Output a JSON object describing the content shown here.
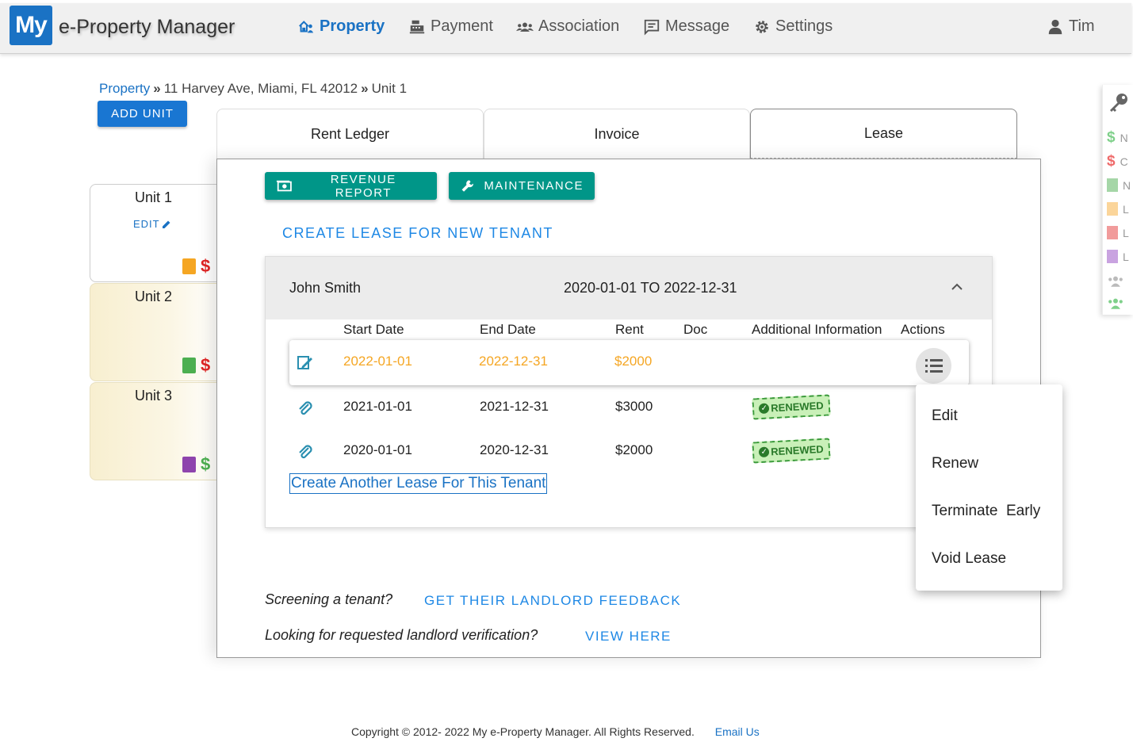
{
  "app": {
    "logo": "My",
    "title": "e-Property Manager"
  },
  "nav": {
    "items": [
      {
        "label": "Property",
        "icon": "house-people-icon"
      },
      {
        "label": "Payment",
        "icon": "cash-register-icon"
      },
      {
        "label": "Association",
        "icon": "users-icon"
      },
      {
        "label": "Message",
        "icon": "message-icon"
      },
      {
        "label": "Settings",
        "icon": "gear-icon"
      }
    ],
    "user": "Tim",
    "active": "Property"
  },
  "breadcrumb": {
    "root": "Property",
    "address": "11 Harvey Ave, Miami, FL 42012",
    "unit": "Unit 1",
    "sep": "»"
  },
  "add_unit_label": "ADD UNIT",
  "units": [
    {
      "name": "Unit 1",
      "edit": "EDIT",
      "doc_color": "#f5a623",
      "dollar_color": "#e02424"
    },
    {
      "name": "Unit 2",
      "doc_color": "#4caf50",
      "dollar_color": "#e02424"
    },
    {
      "name": "Unit 3",
      "doc_color": "#8e44ad",
      "dollar_color": "#4caf50"
    }
  ],
  "tabs": [
    {
      "label": "Rent Ledger"
    },
    {
      "label": "Invoice"
    },
    {
      "label": "Lease"
    }
  ],
  "buttons": {
    "revenue": "REVENUE REPORT",
    "maintenance": "MAINTENANCE"
  },
  "create_lease": "CREATE LEASE FOR NEW TENANT",
  "lease": {
    "tenant": "John Smith",
    "period": "2020-01-01 TO 2022-12-31",
    "headers": {
      "start": "Start Date",
      "end": "End Date",
      "rent": "Rent",
      "doc": "Doc",
      "info": "Additional Information",
      "actions": "Actions"
    },
    "rows": [
      {
        "start": "2022-01-01",
        "end": "2022-12-31",
        "rent": "$2000"
      },
      {
        "start": "2021-01-01",
        "end": "2021-12-31",
        "rent": "$3000",
        "badge": "RENEWED"
      },
      {
        "start": "2020-01-01",
        "end": "2020-12-31",
        "rent": "$2000",
        "badge": "RENEWED"
      }
    ],
    "create_another": "Create Another Lease For This Tenant"
  },
  "menu": {
    "items": [
      "Edit",
      "Renew",
      "Terminate  Early",
      "Void Lease"
    ]
  },
  "screening": {
    "question": "Screening a tenant?",
    "link": "GET THEIR LANDLORD FEEDBACK"
  },
  "verify": {
    "question": "Looking for requested landlord verification?",
    "link": "VIEW HERE"
  },
  "rail": {
    "letters": [
      "N",
      "C",
      "N",
      "L",
      "L",
      "L"
    ]
  },
  "footer": {
    "copyright": "Copyright © 2012- 2022 My e-Property Manager. All Rights Reserved.",
    "email": "Email Us"
  },
  "colors": {
    "accent": "#1a72c4",
    "teal": "#009688",
    "orange": "#f5a623",
    "renewed": "#2a7a2a"
  }
}
